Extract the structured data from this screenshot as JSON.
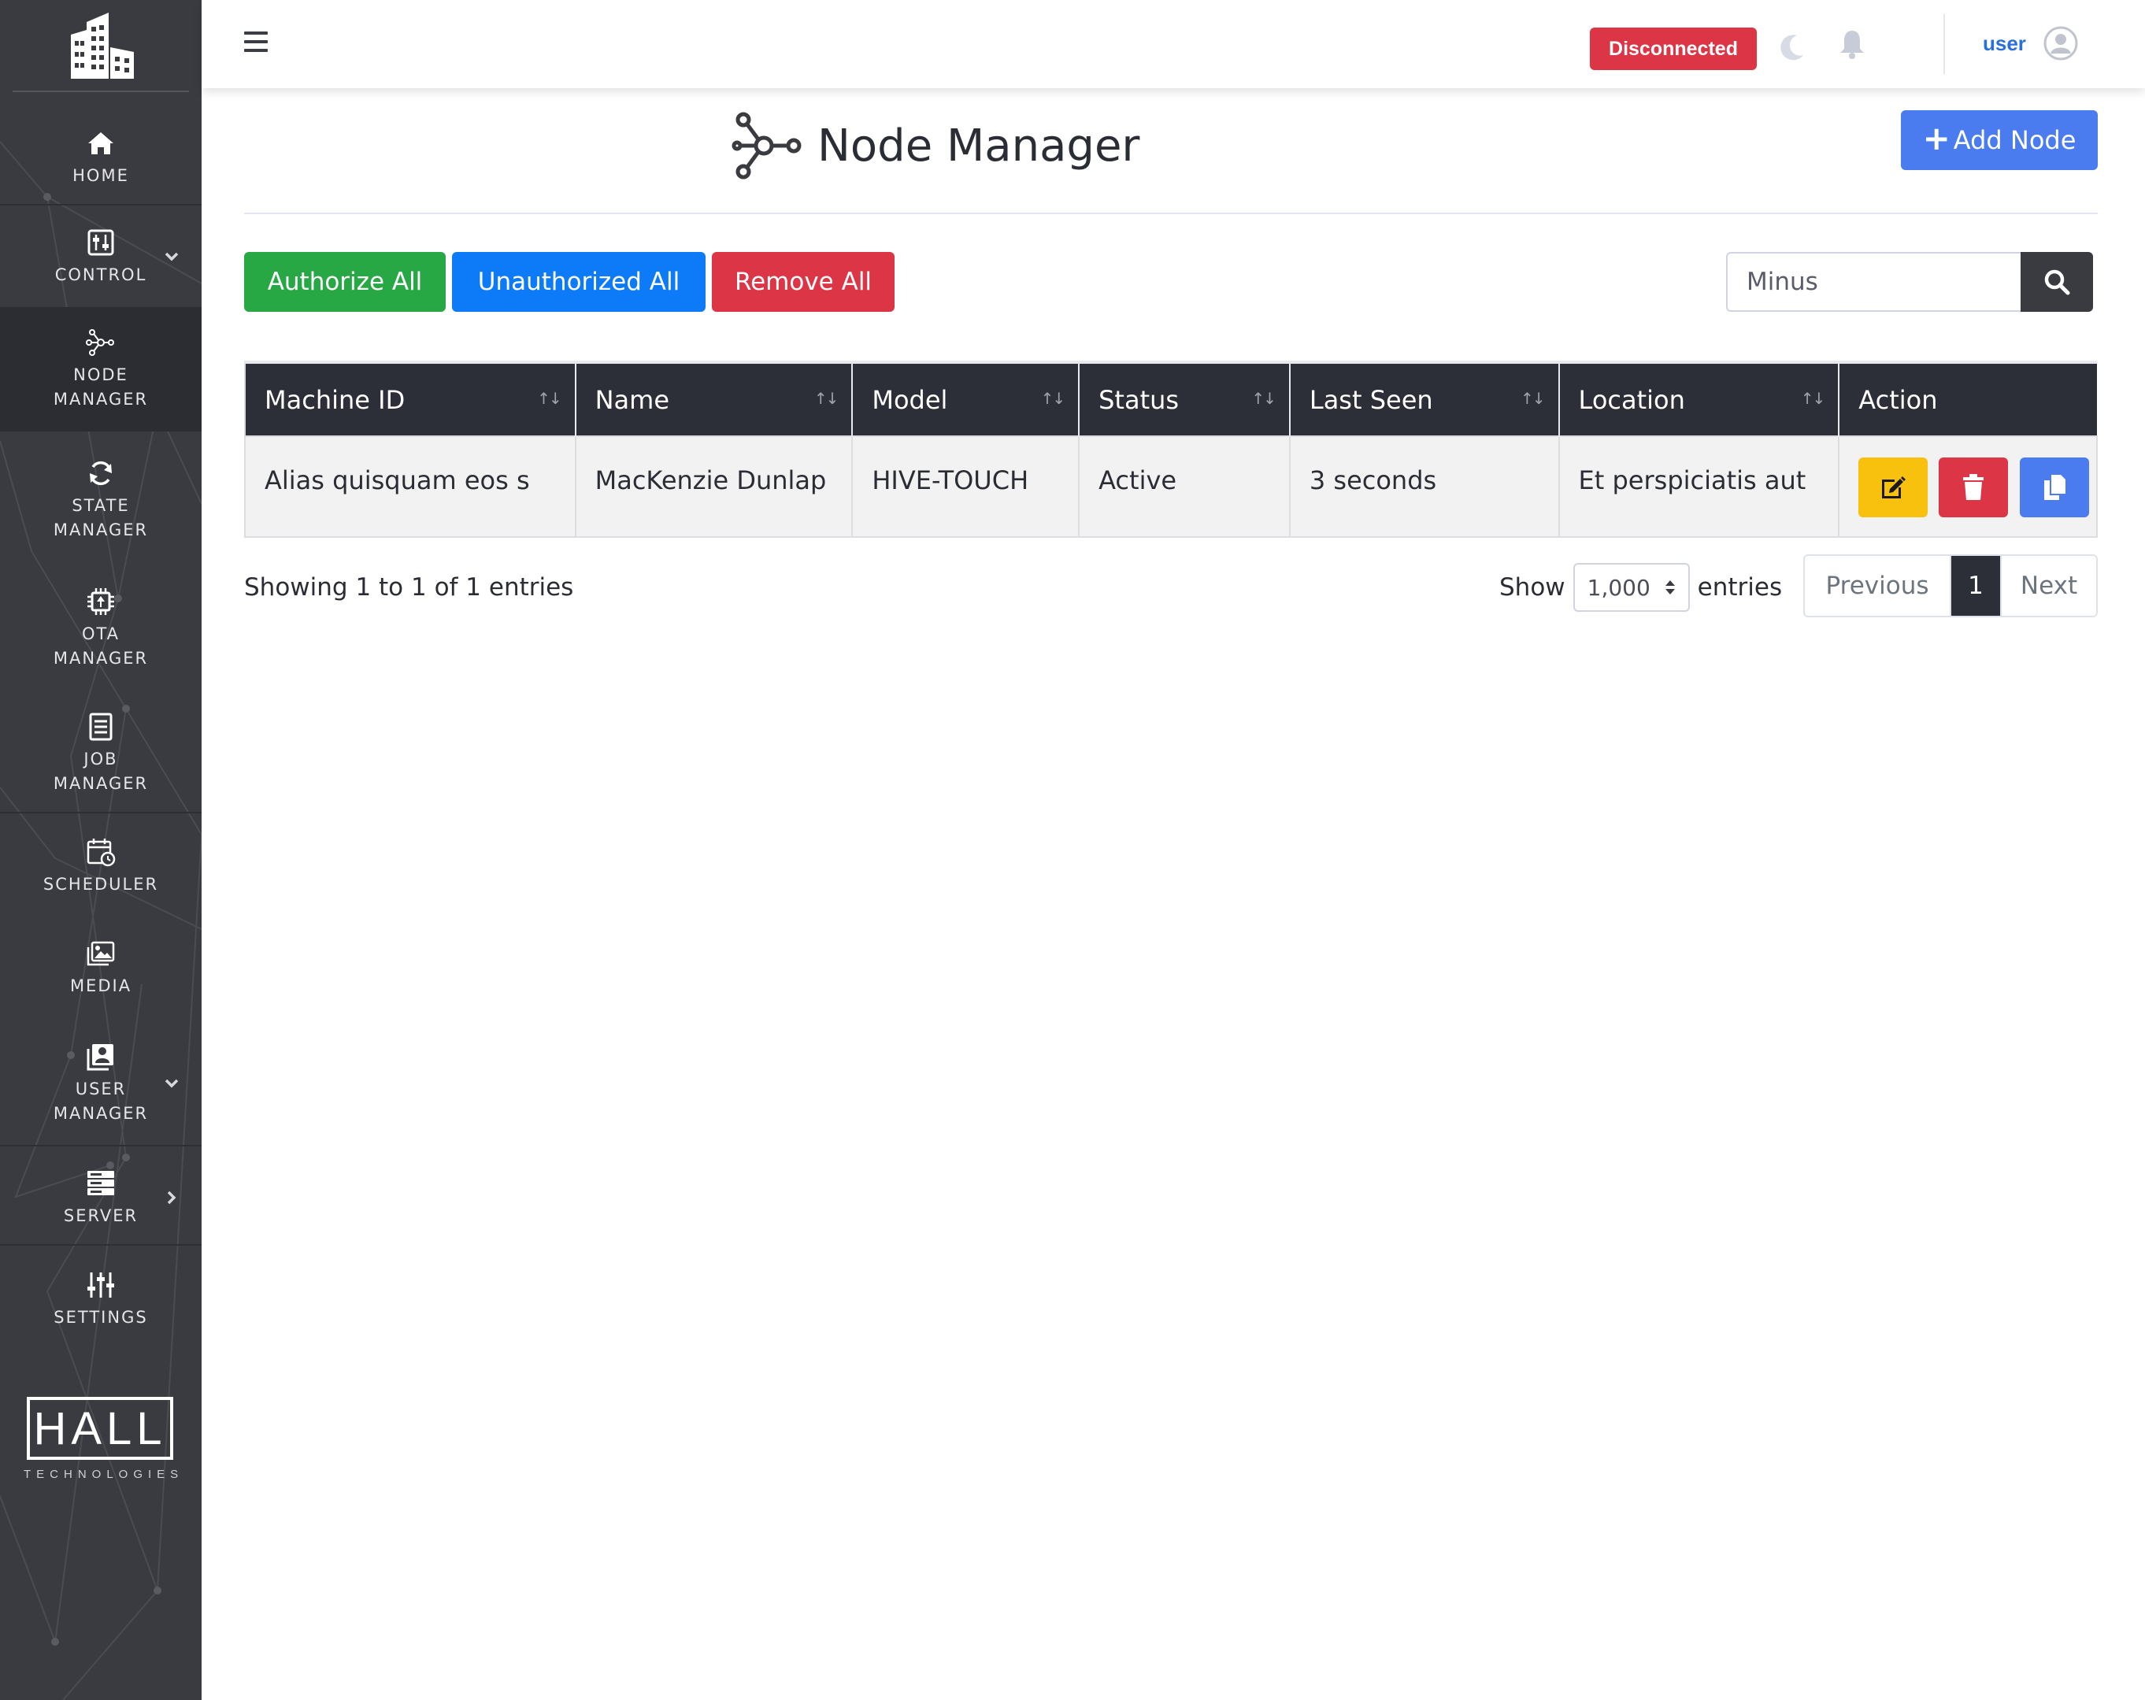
{
  "sidebar": {
    "items": [
      {
        "label": "HOME",
        "icon": "home-icon"
      },
      {
        "label": "CONTROL",
        "icon": "sliders-icon"
      },
      {
        "label": "NODE\nMANAGER",
        "icon": "network-icon"
      },
      {
        "label": "STATE\nMANAGER",
        "icon": "sync-icon"
      },
      {
        "label": "OTA\nMANAGER",
        "icon": "chip-icon"
      },
      {
        "label": "JOB\nMANAGER",
        "icon": "list-icon"
      },
      {
        "label": "SCHEDULER",
        "icon": "calendar-clock-icon"
      },
      {
        "label": "MEDIA",
        "icon": "images-icon"
      },
      {
        "label": "USER\nMANAGER",
        "icon": "user-box-icon"
      },
      {
        "label": "SERVER",
        "icon": "server-icon"
      },
      {
        "label": "SETTINGS",
        "icon": "settings-sliders-icon"
      }
    ],
    "brand": {
      "name": "HALL",
      "subtitle": "TECHNOLOGIES"
    }
  },
  "topbar": {
    "status": "Disconnected",
    "user": "user",
    "colors": {
      "status": "#dc3545",
      "user": "#2a6fdb"
    }
  },
  "page": {
    "title": "Node Manager",
    "add_button": "Add Node"
  },
  "actions": {
    "authorize_all": "Authorize All",
    "unauthorized_all": "Unauthorized All",
    "remove_all": "Remove All"
  },
  "search": {
    "value": "Minus"
  },
  "table": {
    "columns": [
      "Machine ID",
      "Name",
      "Model",
      "Status",
      "Last Seen",
      "Location",
      "Action"
    ],
    "rows": [
      {
        "machine_id": "Alias quisquam eos s",
        "name": "MacKenzie Dunlap",
        "model": "HIVE-TOUCH",
        "status": "Active",
        "last_seen": "3 seconds",
        "location": "Et perspiciatis aut"
      }
    ]
  },
  "footer": {
    "showing": "Showing 1 to 1 of 1 entries",
    "show_label": "Show",
    "page_size": "1,000",
    "entries_label": "entries",
    "previous": "Previous",
    "current_page": "1",
    "next": "Next"
  }
}
